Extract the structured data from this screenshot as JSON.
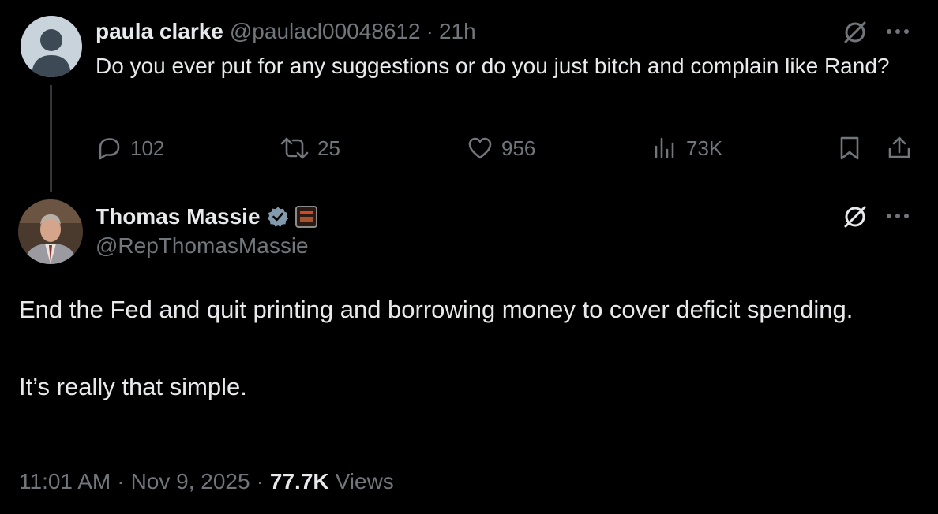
{
  "reply": {
    "author_name": "paula clarke",
    "author_handle": "@paulacl00048612",
    "separator": "·",
    "time": "21h",
    "text": "Do you ever put for any suggestions or do you just bitch and complain like Rand?",
    "actions": {
      "replies": "102",
      "reposts": "25",
      "likes": "956",
      "views": "73K"
    }
  },
  "tweet": {
    "author_name": "Thomas Massie",
    "author_handle": "@RepThomasMassie",
    "text_line_1": "End the Fed and quit printing and borrowing money to cover deficit spending.",
    "text_line_2": "It’s really that simple.",
    "time": "11:01 AM",
    "date": "Nov 9, 2025",
    "separator": "·",
    "views_count": "77.7K",
    "views_label": "Views"
  },
  "icons": {
    "reply": "speech-bubble-icon",
    "repost": "repost-arrows-icon",
    "like": "heart-icon",
    "views": "bar-chart-icon",
    "bookmark": "bookmark-icon",
    "share": "share-upload-icon",
    "grok": "grok-slash-circle-icon",
    "more": "ellipsis-icon",
    "verified": "verified-badge-icon"
  },
  "colors": {
    "background": "#000000",
    "text_primary": "#e7e9ea",
    "text_secondary": "#71767b",
    "thread_line": "#333639",
    "verified_badge": "#829aab"
  }
}
